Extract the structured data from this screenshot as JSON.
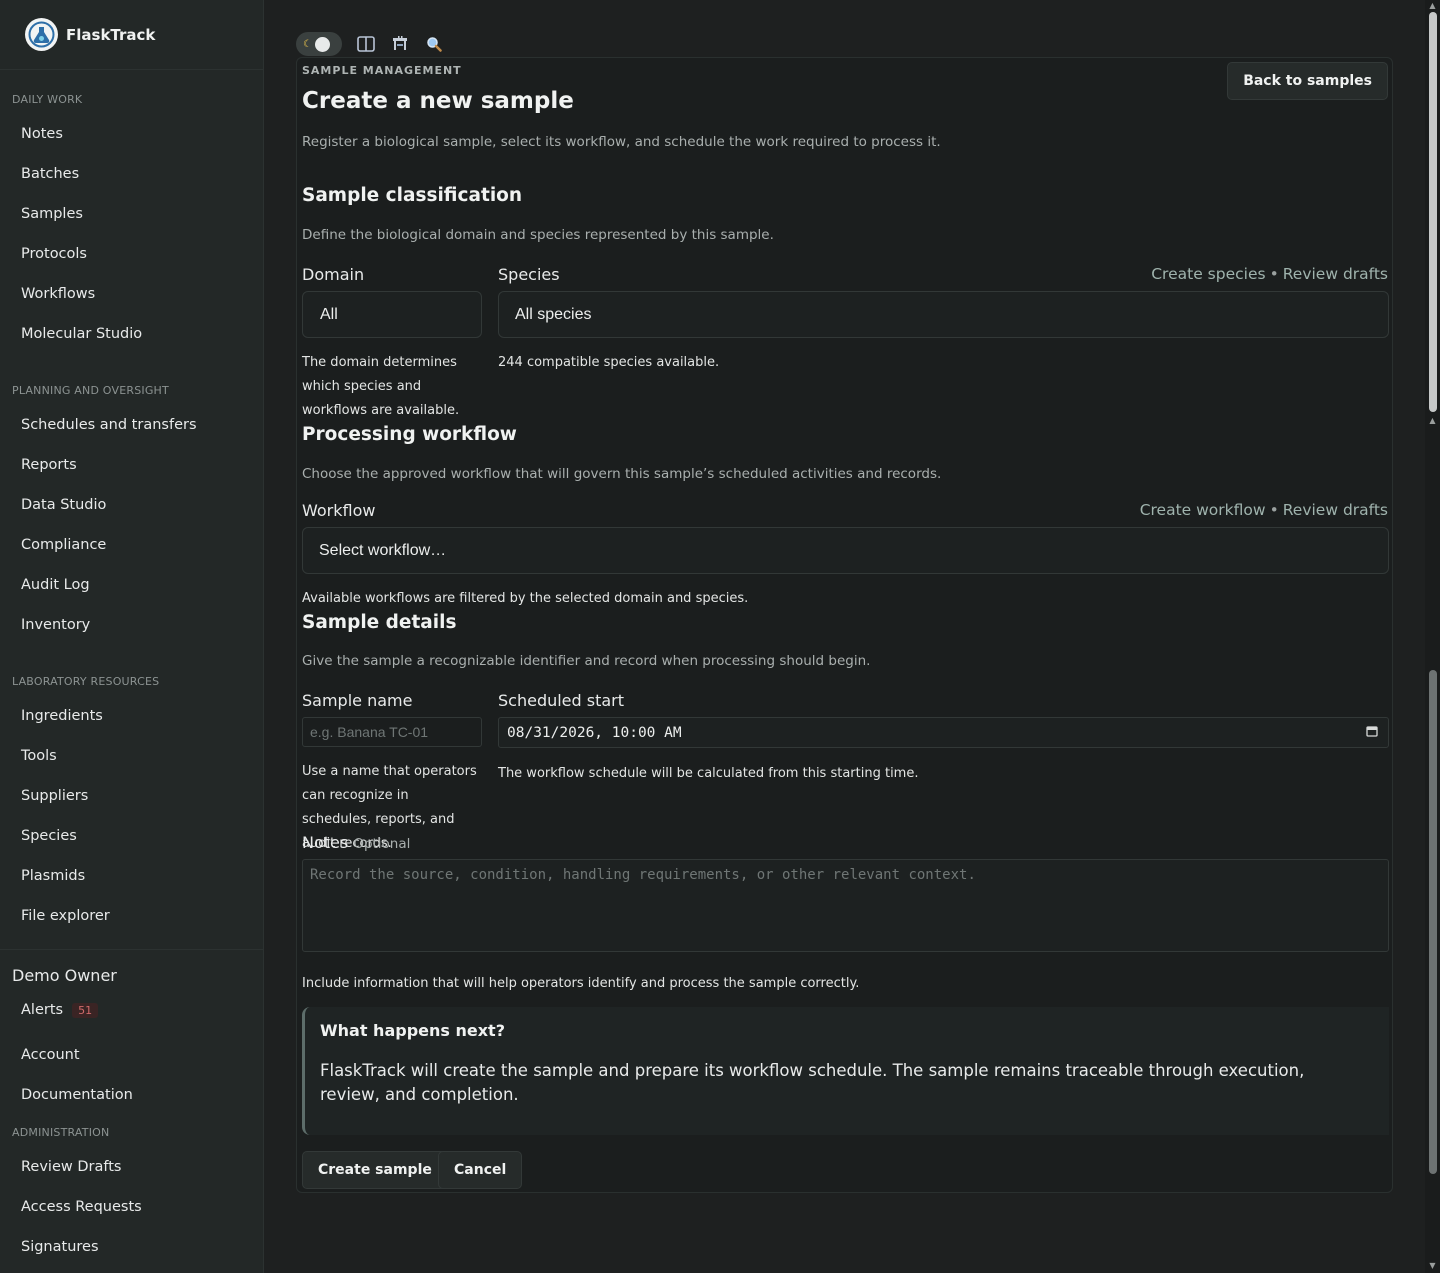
{
  "brand": {
    "name": "FlaskTrack"
  },
  "sidebar": {
    "sections": [
      {
        "heading": "DAILY WORK",
        "items": [
          "Notes",
          "Batches",
          "Samples",
          "Protocols",
          "Workflows",
          "Molecular Studio"
        ]
      },
      {
        "heading": "PLANNING AND OVERSIGHT",
        "items": [
          "Schedules and transfers",
          "Reports",
          "Data Studio",
          "Compliance",
          "Audit Log",
          "Inventory"
        ]
      },
      {
        "heading": "LABORATORY RESOURCES",
        "items": [
          "Ingredients",
          "Tools",
          "Suppliers",
          "Species",
          "Plasmids",
          "File explorer"
        ]
      }
    ],
    "user": {
      "name": "Demo Owner",
      "alerts_label": "Alerts",
      "alerts_count": "51",
      "account": "Account",
      "documentation": "Documentation"
    },
    "admin": {
      "heading": "ADMINISTRATION",
      "items": [
        "Review Drafts",
        "Access Requests",
        "Signatures"
      ]
    }
  },
  "page": {
    "eyebrow": "SAMPLE MANAGEMENT",
    "title": "Create a new sample",
    "back_button": "Back to samples",
    "intro": "Register a biological sample, select its workflow, and schedule the work required to process it."
  },
  "classification": {
    "title": "Sample classification",
    "description": "Define the biological domain and species represented by this sample.",
    "domain_label": "Domain",
    "domain_value": "All",
    "domain_help": "The domain determines which species and workflows are available.",
    "species_label": "Species",
    "species_value": "All species",
    "species_help": "244 compatible species available.",
    "create_link": "Create species",
    "review_link": "Review drafts",
    "separator": "•"
  },
  "workflow": {
    "title": "Processing workflow",
    "description": "Choose the approved workflow that will govern this sample’s scheduled activities and records.",
    "label": "Workflow",
    "placeholder": "Select workflow…",
    "help": "Available workflows are filtered by the selected domain and species.",
    "create_link": "Create workflow",
    "review_link": "Review drafts",
    "separator": "•"
  },
  "details": {
    "title": "Sample details",
    "description": "Give the sample a recognizable identifier and record when processing should begin.",
    "name_label": "Sample name",
    "name_placeholder": "e.g. Banana TC-01",
    "name_help": "Use a name that operators can recognize in schedules, reports, and audit records.",
    "start_label": "Scheduled start",
    "start_value": "08/31/2026, 10:00 AM",
    "start_help": "The workflow schedule will be calculated from this starting time.",
    "notes_label": "Notes",
    "notes_optional": "Optional",
    "notes_placeholder": "Record the source, condition, handling requirements, or other relevant context.",
    "notes_help": "Include information that will help operators identify and process the sample correctly."
  },
  "callout": {
    "title": "What happens next?",
    "body": "FlaskTrack will create the sample and prepare its workflow schedule. The sample remains traceable through execution, review, and completion."
  },
  "actions": {
    "create": "Create sample",
    "cancel": "Cancel"
  }
}
